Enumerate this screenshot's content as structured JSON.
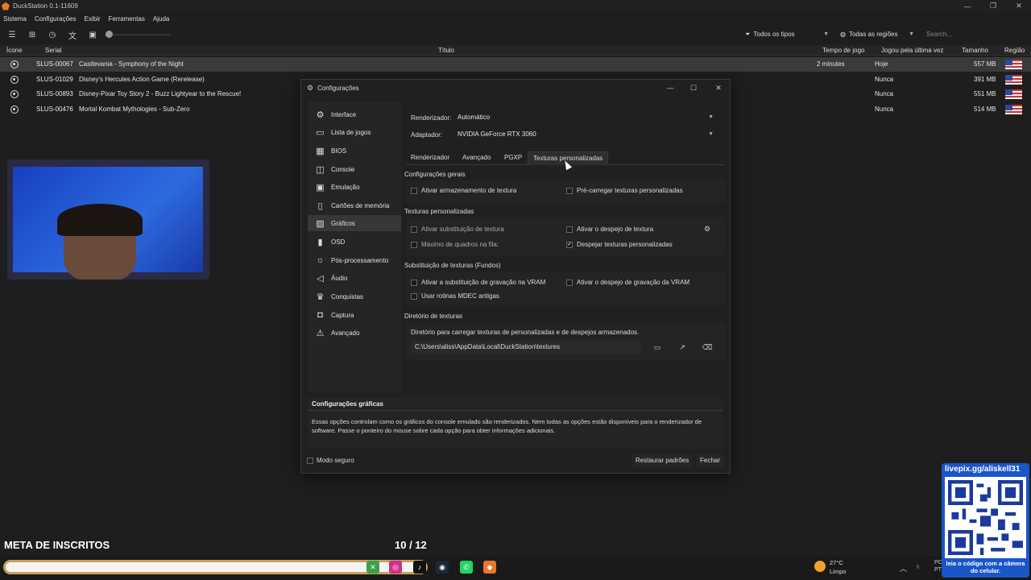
{
  "window": {
    "title": "DuckStation 0.1-11609"
  },
  "menu": [
    "Sistema",
    "Configurações",
    "Exibir",
    "Ferramentas",
    "Ajuda"
  ],
  "toolbar": {
    "icons": [
      "list-icon",
      "grid-icon",
      "clock-icon",
      "translate-icon",
      "image-icon"
    ],
    "filter_types": "Todos os tipos",
    "filter_regions": "Todas as regiões",
    "search_placeholder": "Search..."
  },
  "table": {
    "headers": {
      "icon": "Ícone",
      "serial": "Serial",
      "title": "Título",
      "playtime": "Tempo de jogo",
      "lastplayed": "Jogou pela última vez",
      "size": "Tamanho",
      "region": "Região"
    },
    "rows": [
      {
        "serial": "SLUS-00067",
        "title": "Castlevania - Symphony of the Night",
        "playtime": "2 minutes",
        "lastplayed": "Hoje",
        "size": "557 MB"
      },
      {
        "serial": "SLUS-01029",
        "title": "Disney's Hercules Action Game (Rerelease)",
        "playtime": "",
        "lastplayed": "Nunca",
        "size": "391 MB"
      },
      {
        "serial": "SLUS-00893",
        "title": "Disney-Pixar Toy Story 2 - Buzz Lightyear to the Rescue!",
        "playtime": "",
        "lastplayed": "Nunca",
        "size": "551 MB"
      },
      {
        "serial": "SLUS-00476",
        "title": "Mortal Kombat Mythologies - Sub-Zero",
        "playtime": "",
        "lastplayed": "Nunca",
        "size": "514 MB"
      }
    ]
  },
  "dialog": {
    "title": "Configurações",
    "sidebar": [
      "Interface",
      "Lista de jogos",
      "BIOS",
      "Console",
      "Emulação",
      "Cartões de memória",
      "Gráficos",
      "OSD",
      "Pós-processamento",
      "Áudio",
      "Conquistas",
      "Captura",
      "Avançado"
    ],
    "sidebar_active": "Gráficos",
    "renderer_label": "Renderizador:",
    "renderer_value": "Automático",
    "adapter_label": "Adaptador:",
    "adapter_value": "NVIDIA GeForce RTX 3060",
    "tabs": [
      "Renderizador",
      "Avançado",
      "PGXP",
      "Texturas personalizadas"
    ],
    "active_tab": "Texturas personalizadas",
    "general_section": "Configurações gerais",
    "enable_texture_cache": "Ativar armazenamento de textura",
    "preload_textures": "Pré-carregar texturas personalizadas",
    "custom_section": "Texturas personalizadas",
    "enable_texture_replacement": "Ativar substituição de textura",
    "enable_texture_dump": "Ativar o despejo de textura",
    "max_frames": "Máximo de quadros na fila:",
    "dump_custom": "Despejar texturas personalizadas",
    "bg_section": "Substituição de texturas (Fundos)",
    "vram_write_replace": "Ativar a substituição de gravação na VRAM",
    "vram_write_dump": "Ativar o despejo de gravação da VRAM",
    "mdec_routines": "Usar rotinas MDEC antigas",
    "dir_section": "Diretório de texturas",
    "dir_desc": "Diretório para carregar texturas de personalizadas e de despejos armazenados.",
    "dir_path": "C:\\Users\\aliss\\AppData\\Local\\DuckStation\\textures",
    "info_title": "Configurações gráficas",
    "info_text": "Essas opções controlam como os gráficos do console emulado são renderizados. Nem todas as opções estão disponíveis para o renderizador de software. Passe o ponteiro do mouse sobre cada opção para obter informações adicionais.",
    "safe_mode": "Modo seguro",
    "restore_button": "Restaurar padrões",
    "close_button": "Fechar"
  },
  "overlay": {
    "goal_label": "META DE INSCRITOS",
    "goal_progress": "10 / 12"
  },
  "qr": {
    "link": "livepix.gg/aliskell31",
    "caption": "leia o código com a câmera do celular."
  },
  "weather": {
    "temp": "27°C",
    "condition": "Limpo"
  },
  "tray": {
    "lang": "PC",
    "lang2": "PT"
  },
  "colors": {
    "accent": "#e8782a",
    "selected_row": "#3a3a3a",
    "dialog_bg": "#202020"
  }
}
